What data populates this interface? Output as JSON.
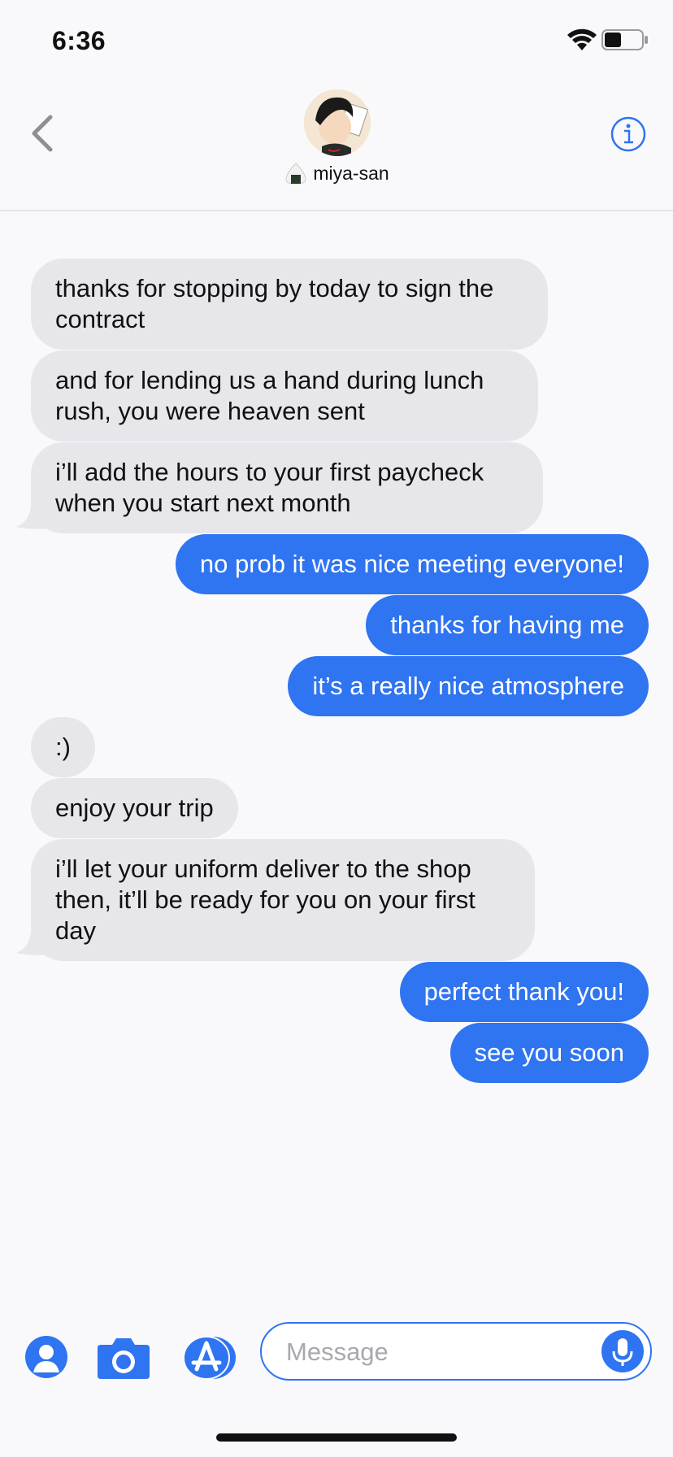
{
  "status_bar": {
    "time": "6:36",
    "battery_level": 0.45
  },
  "header": {
    "contact_name": "miya-san",
    "emoji_icon": "rice-ball-icon"
  },
  "colors": {
    "accent": "#2f74f0",
    "incoming_bubble": "#e6e6eb",
    "background": "#f9f9fb"
  },
  "messages": [
    {
      "from": "them",
      "text": "thanks for stopping by today to sign the contract"
    },
    {
      "from": "them",
      "text": "and for lending us a hand during lunch rush, you were heaven sent"
    },
    {
      "from": "them",
      "text": "i’ll add the hours to your first paycheck when you start next month"
    },
    {
      "from": "me",
      "text": "no prob it was nice meeting everyone!"
    },
    {
      "from": "me",
      "text": "thanks for having me"
    },
    {
      "from": "me",
      "text": "it’s a really nice atmosphere"
    },
    {
      "from": "them",
      "text": ":)"
    },
    {
      "from": "them",
      "text": "enjoy your trip"
    },
    {
      "from": "them",
      "text": "i’ll let your uniform deliver to the shop then, it’ll be ready for you on your first day"
    },
    {
      "from": "me",
      "text": "perfect thank you!"
    },
    {
      "from": "me",
      "text": "see you soon"
    }
  ],
  "input_bar": {
    "placeholder": "Message"
  }
}
